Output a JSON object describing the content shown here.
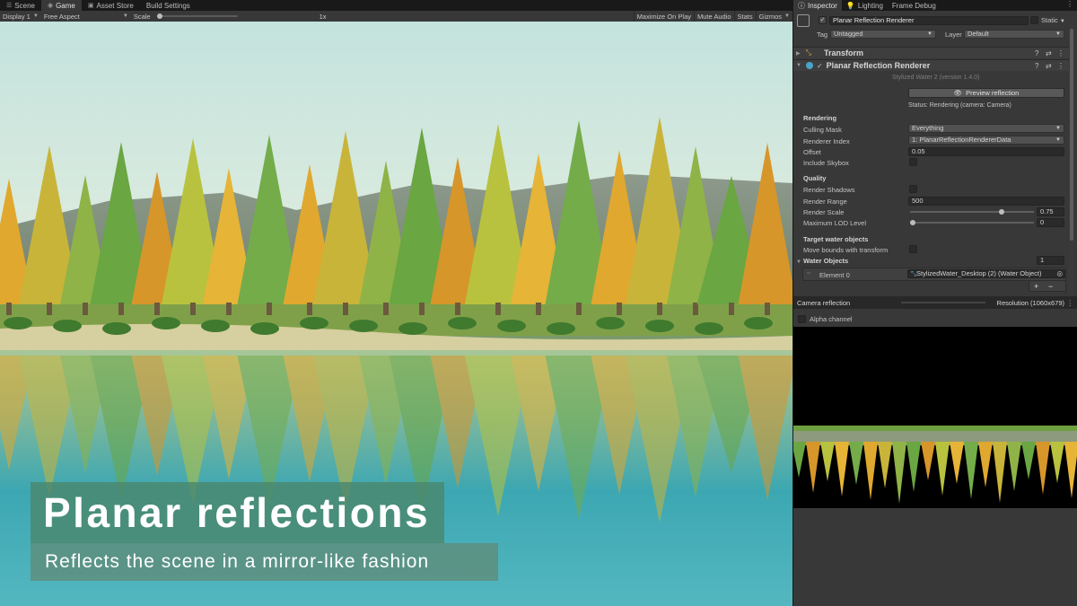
{
  "editor_tabs": [
    {
      "label": "Scene",
      "icon": "scene-icon",
      "active": false
    },
    {
      "label": "Game",
      "icon": "game-controller-icon",
      "active": true
    },
    {
      "label": "Asset Store",
      "icon": "store-icon",
      "active": false
    },
    {
      "label": "Build Settings",
      "icon": "",
      "active": false
    }
  ],
  "game_toolbar": {
    "display": "Display 1",
    "aspect": "Free Aspect",
    "scale_label": "Scale",
    "scale_value": "1x",
    "scale_level": 0,
    "maximize": "Maximize On Play",
    "mute": "Mute Audio",
    "stats": "Stats",
    "gizmos": "Gizmos"
  },
  "caption": {
    "title": "Planar reflections",
    "subtitle": "Reflects the scene in a mirror-like fashion"
  },
  "inspector_tabs": [
    {
      "label": "Inspector",
      "icon": "info-icon",
      "active": true
    },
    {
      "label": "Lighting",
      "icon": "bulb-icon",
      "active": false
    },
    {
      "label": "Frame Debug",
      "icon": "",
      "active": false
    }
  ],
  "object": {
    "name": "Planar Reflection Renderer",
    "static_label": "Static",
    "tag_label": "Tag",
    "tag": "Untagged",
    "layer_label": "Layer",
    "layer": "Default"
  },
  "components": {
    "transform": "Transform",
    "planar": "Planar Reflection Renderer",
    "version": "Stylized Water 2 (version 1.4.0)",
    "preview_button": "Preview reflection",
    "status": "Status: Rendering (camera: Camera)"
  },
  "rendering": {
    "header": "Rendering",
    "culling_mask_label": "Culling Mask",
    "culling_mask": "Everything",
    "renderer_index_label": "Renderer Index",
    "renderer_index": "1: PlanarReflectionRendererData",
    "offset_label": "Offset",
    "offset": "0.05",
    "skybox_label": "Include Skybox",
    "skybox": false
  },
  "quality": {
    "header": "Quality",
    "shadows_label": "Render Shadows",
    "shadows": false,
    "range_label": "Render Range",
    "range": "500",
    "scale_label": "Render Scale",
    "scale": "0.75",
    "scale_level": 0.75,
    "lod_label": "Maximum LOD Level",
    "lod": "0",
    "lod_level": 0
  },
  "target": {
    "header": "Target water objects",
    "move_bounds_label": "Move bounds with transform",
    "move_bounds": false,
    "water_objects_label": "Water Objects",
    "water_objects_count": "1",
    "element_label": "Element 0",
    "element_value": "StylizedWater_Desktop (2) (Water Object)",
    "add": "+",
    "remove": "−"
  },
  "camera_reflection": {
    "title": "Camera reflection",
    "resolution": "Resolution (1060x679)",
    "alpha_label": "Alpha channel"
  },
  "colors": {
    "editor_dark": "#191919",
    "panel": "#383838",
    "caption_bg": "#4b876e",
    "water": "#3fa9b4",
    "sky": "#cfe6dc"
  }
}
